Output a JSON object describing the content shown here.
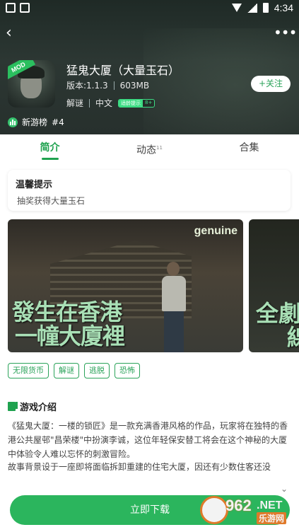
{
  "status_bar": {
    "time": "4:34"
  },
  "app": {
    "name": "猛鬼大厦（大量玉石）",
    "version": "版本:1.1.3",
    "size": "603MB",
    "genre": "解谜",
    "language": "中文",
    "age_badge_left": "适龄提示",
    "age_badge_right": "8+",
    "mod_label": "MOD",
    "follow_label": "+关注",
    "rank_label": "新游榜",
    "rank_value": "#4"
  },
  "tabs": [
    {
      "label": "简介",
      "active": true
    },
    {
      "label": "动态",
      "badge": "11"
    },
    {
      "label": "合集"
    }
  ],
  "tip": {
    "title": "温馨提示",
    "text": "抽奖获得大量玉石"
  },
  "screenshots": [
    {
      "brand": "genuine",
      "line1": "發生在香港",
      "line2": "一幢大廈裡"
    },
    {
      "line1": "全劇",
      "line2": "線"
    }
  ],
  "tags": [
    "无限货币",
    "解谜",
    "逃脱",
    "恐怖"
  ],
  "intro": {
    "title": "游戏介绍",
    "paragraph1": "《猛鬼大厦：一楼的锁匠》是一款充满香港风格的作品，玩家将在独特的香港公共屋邨\"昌荣楼\"中扮演李诚，这位年轻保安替工将会在这个神秘的大厦中体验令人难以忘怀的刺激冒险。",
    "paragraph2": "故事背景设于一座即将面临拆卸重建的住宅大厦，因还有少数住客还没",
    "expand_icon": "chevron-down-icon"
  },
  "download": {
    "label": "立即下载"
  },
  "watermark": {
    "number": "962",
    "suffix": ".NET",
    "cn": "乐游网"
  },
  "colors": {
    "accent": "#2bb55d",
    "header_bg": "#27302d"
  }
}
